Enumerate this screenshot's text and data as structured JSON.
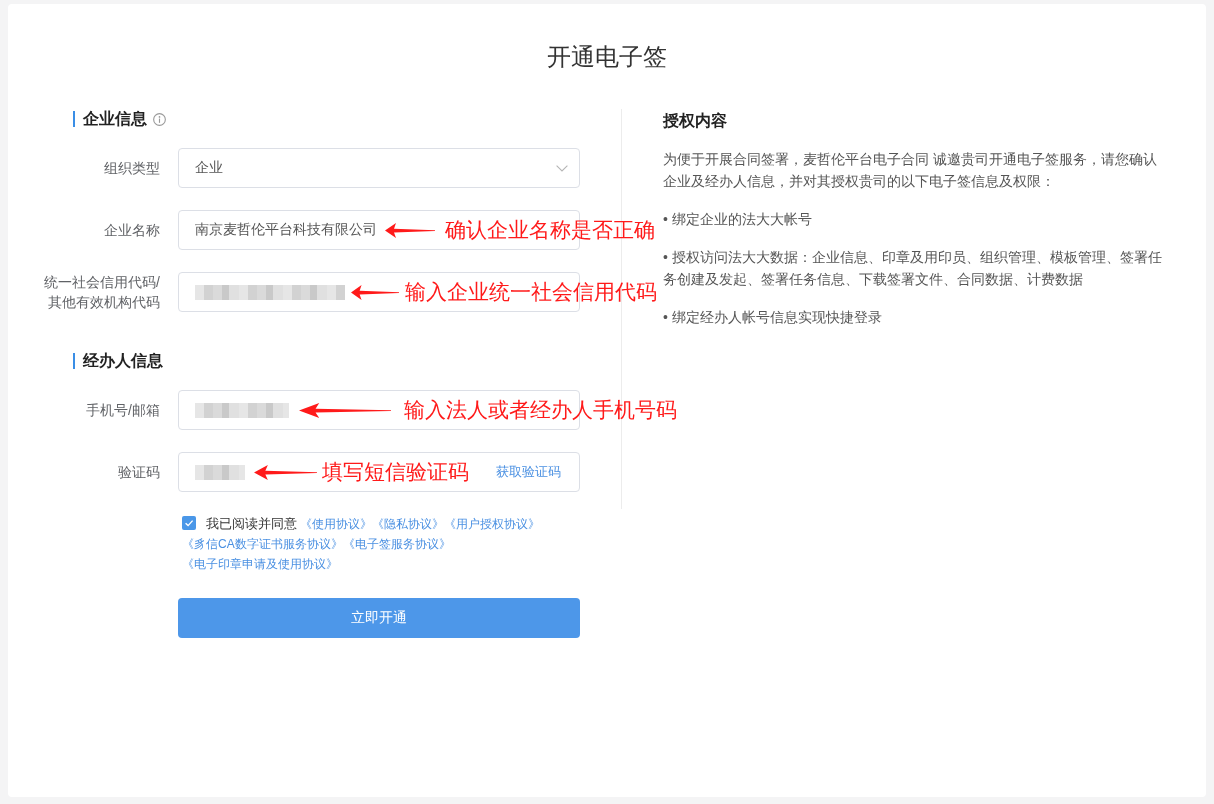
{
  "page": {
    "title": "开通电子签"
  },
  "form": {
    "sections": [
      {
        "title": "企业信息",
        "info_icon": true,
        "fields": [
          {
            "kind": "select",
            "label": "组织类型",
            "value": "企业"
          },
          {
            "kind": "text",
            "label": "企业名称",
            "value": "南京麦哲伦平台科技有限公司",
            "note": "确认企业名称是否正确"
          },
          {
            "kind": "text",
            "label": "统一社会信用代码/其他有效机构代码",
            "blurred": true,
            "note": "输入企业统一社会信用代码"
          }
        ]
      },
      {
        "title": "经办人信息",
        "info_icon": false,
        "fields": [
          {
            "kind": "text",
            "label": "手机号/邮箱",
            "blurred": true,
            "note": "输入法人或者经办人手机号码"
          },
          {
            "kind": "code",
            "label": "验证码",
            "blurred": true,
            "note": "填写短信验证码",
            "action": "获取验证码"
          }
        ]
      }
    ],
    "agreement": {
      "checked": true,
      "lead": "我已阅读并同意",
      "links": [
        "《使用协议》",
        "《隐私协议》",
        "《用户授权协议》",
        "《豸信CA数字证书服务协议》",
        "《电子签服务协议》",
        "《电子印章申请及使用协议》"
      ]
    },
    "submit_button": "立即开通"
  },
  "authorization": {
    "title": "授权内容",
    "intro": "为便于开展合同签署，麦哲伦平台电子合同 诚邀贵司开通电子签服务，请您确认企业及经办人信息，并对其授权贵司的以下电子签信息及权限：",
    "items": [
      "• 绑定企业的法大大帐号",
      "• 授权访问法大大数据：企业信息、印章及用印员、组织管理、模板管理、签署任务创建及发起、签署任务信息、下载签署文件、合同数据、计费数据",
      "• 绑定经办人帐号信息实现快捷登录"
    ]
  }
}
